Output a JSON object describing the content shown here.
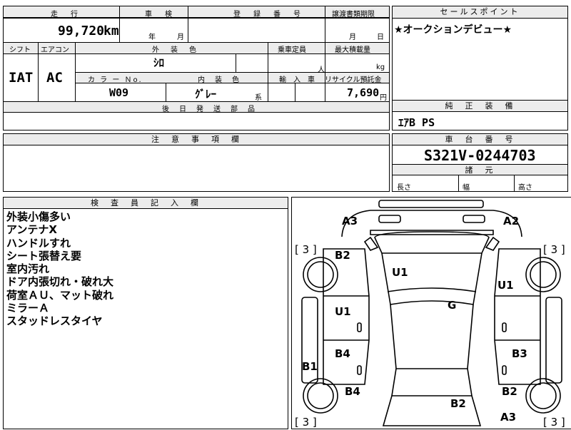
{
  "header": {
    "mileage_label": "走　行",
    "mileage_value": "99,720",
    "mileage_unit": "km",
    "inspection_label": "車　検",
    "inspection_year": "年",
    "inspection_month": "月",
    "reg_label": "登　録　番　号",
    "transfer_label": "譲渡書類期限",
    "transfer_month": "月",
    "transfer_day": "日",
    "shift_label": "シフト",
    "aircon_label": "エアコン",
    "shift_value": "IAT",
    "aircon_value": "AC",
    "exterior_label": "外　装　色",
    "exterior_value": "ｼﾛ",
    "capacity_label": "乗車定員",
    "capacity_unit": "人",
    "maxload_label": "最大積載量",
    "maxload_unit": "kg",
    "color_no_label": "カ ラ ー Ｎo.",
    "color_no_value": "W09",
    "interior_label": "内　装　色",
    "interior_value": "ｸﾞﾚｰ",
    "interior_suffix": "系",
    "import_label": "輸　入　車",
    "recycle_label": "リサイクル預託金",
    "recycle_value": "7,690",
    "recycle_unit": "円",
    "later_parts_label": "後　日　発　送　部　品"
  },
  "sales_point": {
    "label": "セールスポイント",
    "text": "★オークションデビュー★"
  },
  "genuine_equipment": {
    "label": "純　正　装　備",
    "value": "ｴｱB  PS"
  },
  "caution": {
    "label": "注　意　事　項　欄"
  },
  "chassis": {
    "label": "車　台　番　号",
    "value": "S321V-0244703",
    "specs_label": "諸　元",
    "length_label": "長さ",
    "width_label": "幅",
    "height_label": "高さ"
  },
  "inspector": {
    "label": "検　査　員　記　入　欄",
    "notes": [
      "外装小傷多い",
      "アンテナX",
      "ハンドルすれ",
      "シート張替え要",
      "室内汚れ",
      "ドア内張切れ・破れ大",
      "荷室ＡＵ、マット破れ",
      "ミラーＡ",
      "スタッドレスタイヤ"
    ]
  },
  "diagram": {
    "front_left": "A3",
    "front_right": "A2",
    "front_left_fender": "B2",
    "hood": "U1",
    "right_fender": "U1",
    "left_front_door": "U1",
    "roof": "G",
    "left_rear_door": "B4",
    "right_rear_door": "B3",
    "left_rocker": "B1",
    "left_rear_fender": "B4",
    "right_rear_fender": "B2",
    "rear_hatch": "B2",
    "rear_right": "A3",
    "tire_fl": "[ 3 ]",
    "tire_fr": "[ 3 ]",
    "tire_rl": "[ 3 ]",
    "tire_rr": "[ 3 ]"
  }
}
